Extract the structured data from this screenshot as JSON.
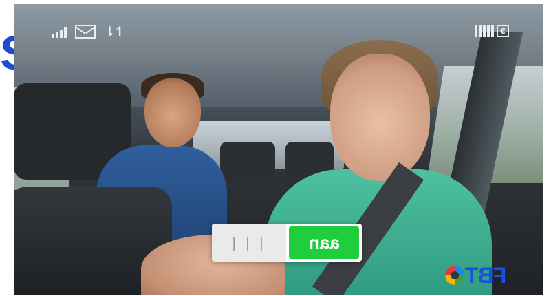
{
  "background_letter": "S",
  "hud": {
    "signal_icon": "signal-bars-icon",
    "mail_icon": "envelope-icon",
    "data_icon": "data-transfer-icon",
    "data_glyph": "⇂↿",
    "battery_icon": "battery-icon",
    "battery_symbol": "€"
  },
  "toggle": {
    "off_label": "| | |",
    "on_label": "aan",
    "on_state": true,
    "on_color": "#1fce3d"
  },
  "logo": {
    "text": "FBT",
    "colors": [
      "#1a4fe0",
      "#e53935",
      "#ffb300",
      "#43a047"
    ]
  }
}
